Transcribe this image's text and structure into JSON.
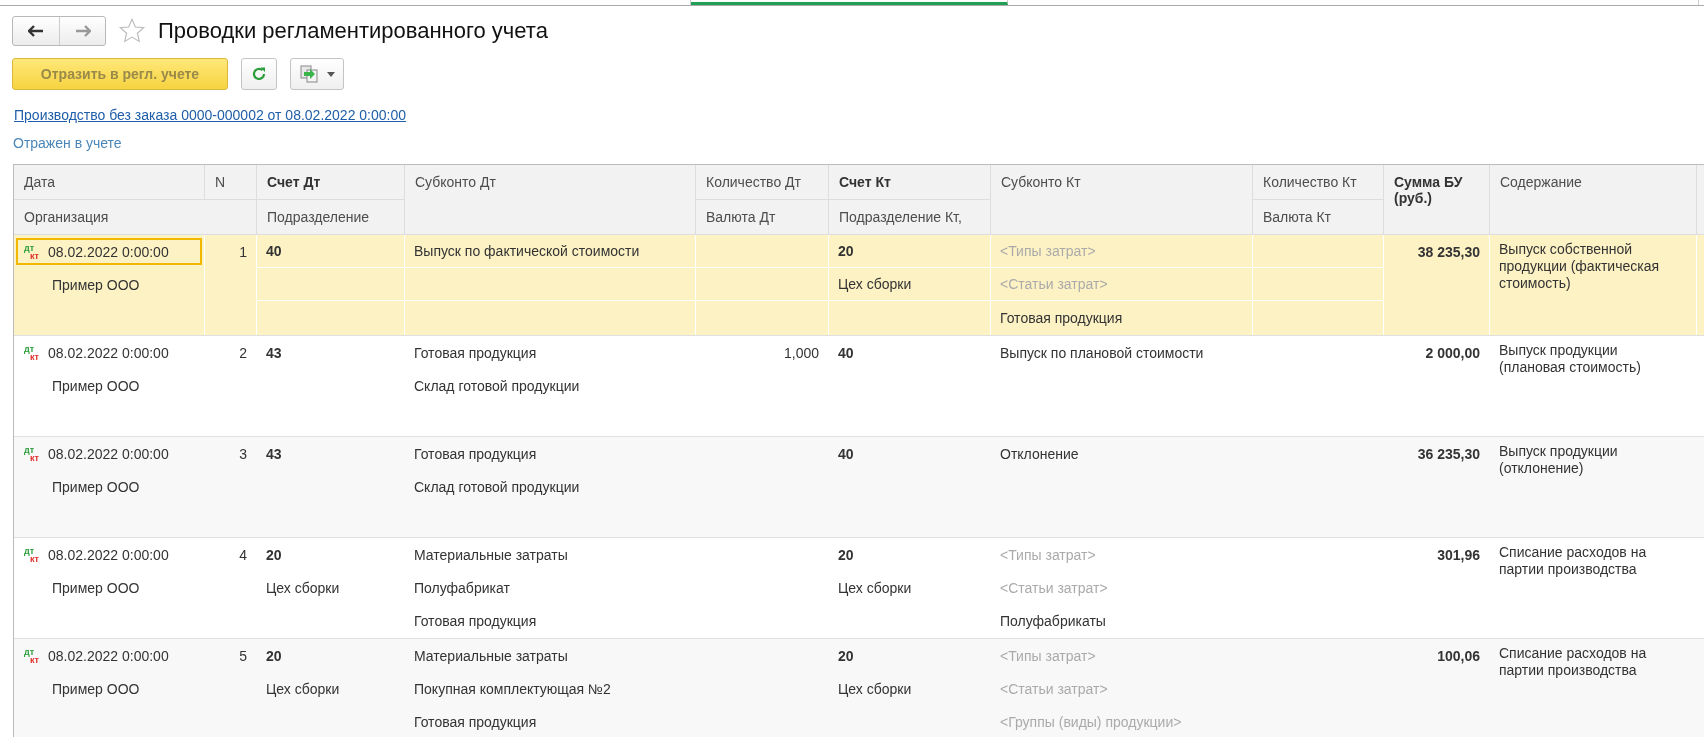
{
  "window": {
    "title": "Проводки регламентированного учета",
    "favorite": false
  },
  "toolbar": {
    "post_button": "Отразить в регл. учете",
    "post_disabled": true
  },
  "document_link": "Производство без заказа 0000-000002 от 08.02.2022 0:00:00",
  "status": "Отражен в учете",
  "header": {
    "top": [
      {
        "label": "Дата",
        "strong": false
      },
      {
        "label": "N",
        "strong": false
      },
      {
        "label": "Счет Дт",
        "strong": true
      },
      {
        "label": "Субконто Дт",
        "strong": false
      },
      {
        "label": "Количество Дт",
        "strong": false
      },
      {
        "label": "Счет Кт",
        "strong": true
      },
      {
        "label": "Субконто Кт",
        "strong": false
      },
      {
        "label": "Количество Кт",
        "strong": false
      },
      {
        "label": "Сумма БУ (руб.)",
        "strong": true
      },
      {
        "label": "Содержание",
        "strong": false
      }
    ],
    "bottom": [
      {
        "label": "Организация"
      },
      {
        "label": "Подразделение"
      },
      {
        "label": "Валюта Дт"
      },
      {
        "label": "Подразделение Кт,"
      },
      {
        "label": "Валюта Кт"
      }
    ]
  },
  "rows": [
    {
      "selected": true,
      "mark_dt": "дт",
      "mark_kt": "кт",
      "date": "08.02.2022 0:00:00",
      "n": "1",
      "org": "Пример ООО",
      "acct_dt": "40",
      "div_dt": "",
      "subconto_dt": [
        {
          "text": "Выпуск по фактической стоимости",
          "empty": false
        }
      ],
      "qty_dt": "",
      "acct_kt": "20",
      "div_kt": "Цех сборки",
      "subconto_kt": [
        {
          "text": "<Типы затрат>",
          "empty": true
        },
        {
          "text": "<Статьи затрат>",
          "empty": true
        },
        {
          "text": "Готовая продукция",
          "empty": false
        }
      ],
      "sum": "38 235,30",
      "content": "Выпуск собственной продукции (фактическая стоимость)"
    },
    {
      "selected": false,
      "mark_dt": "дт",
      "mark_kt": "кт",
      "date": "08.02.2022 0:00:00",
      "n": "2",
      "org": "Пример ООО",
      "acct_dt": "43",
      "div_dt": "",
      "subconto_dt": [
        {
          "text": "Готовая продукция",
          "empty": false
        },
        {
          "text": "Склад готовой продукции",
          "empty": false
        }
      ],
      "qty_dt": "1,000",
      "acct_kt": "40",
      "div_kt": "",
      "subconto_kt": [
        {
          "text": "Выпуск по плановой стоимости",
          "empty": false
        }
      ],
      "sum": "2 000,00",
      "content": "Выпуск продукции (плановая стоимость)"
    },
    {
      "selected": false,
      "mark_dt": "дт",
      "mark_kt": "кт",
      "date": "08.02.2022 0:00:00",
      "n": "3",
      "org": "Пример ООО",
      "acct_dt": "43",
      "div_dt": "",
      "subconto_dt": [
        {
          "text": "Готовая продукция",
          "empty": false
        },
        {
          "text": "Склад готовой продукции",
          "empty": false
        }
      ],
      "qty_dt": "",
      "acct_kt": "40",
      "div_kt": "",
      "subconto_kt": [
        {
          "text": "Отклонение",
          "empty": false
        }
      ],
      "sum": "36 235,30",
      "content": "Выпуск продукции (отклонение)"
    },
    {
      "selected": false,
      "mark_dt": "дт",
      "mark_kt": "кт",
      "date": "08.02.2022 0:00:00",
      "n": "4",
      "org": "Пример ООО",
      "acct_dt": "20",
      "div_dt": "Цех сборки",
      "subconto_dt": [
        {
          "text": "Материальные затраты",
          "empty": false
        },
        {
          "text": "Полуфабрикат",
          "empty": false
        },
        {
          "text": "Готовая продукция",
          "empty": false
        }
      ],
      "qty_dt": "",
      "acct_kt": "20",
      "div_kt": "Цех сборки",
      "subconto_kt": [
        {
          "text": "<Типы затрат>",
          "empty": true
        },
        {
          "text": "<Статьи затрат>",
          "empty": true
        },
        {
          "text": "Полуфабрикаты",
          "empty": false
        }
      ],
      "sum": "301,96",
      "content": "Списание расходов на партии производства"
    },
    {
      "selected": false,
      "mark_dt": "дт",
      "mark_kt": "кт",
      "date": "08.02.2022 0:00:00",
      "n": "5",
      "org": "Пример ООО",
      "acct_dt": "20",
      "div_dt": "Цех сборки",
      "subconto_dt": [
        {
          "text": "Материальные затраты",
          "empty": false
        },
        {
          "text": "Покупная комплектующая №2",
          "empty": false
        },
        {
          "text": "Готовая продукция",
          "empty": false
        }
      ],
      "qty_dt": "",
      "acct_kt": "20",
      "div_kt": "Цех сборки",
      "subconto_kt": [
        {
          "text": "<Типы затрат>",
          "empty": true
        },
        {
          "text": "<Статьи затрат>",
          "empty": true
        },
        {
          "text": "<Группы (виды) продукции>",
          "empty": true
        }
      ],
      "sum": "100,06",
      "content": "Списание расходов на партии производства"
    }
  ]
}
